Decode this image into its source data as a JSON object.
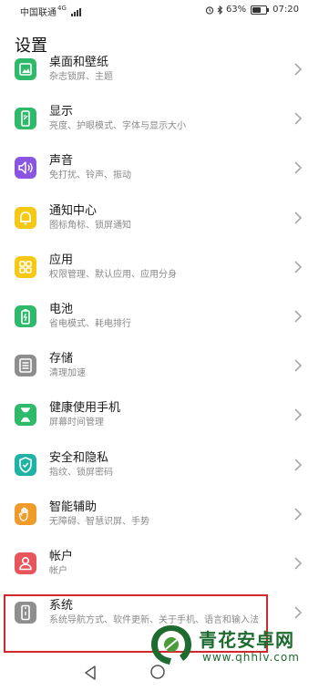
{
  "status_bar": {
    "carrier": "中国联通",
    "network": "4G",
    "battery_percent": "63%",
    "battery_level": 0.63,
    "time": "07:20"
  },
  "title": "设置",
  "items": [
    {
      "title": "桌面和壁纸",
      "subtitle": "杂志锁屏、主题",
      "icon": "wallpaper-icon",
      "color": "#2fba6b"
    },
    {
      "title": "显示",
      "subtitle": "亮度、护眼模式、字体与显示大小",
      "icon": "display-icon",
      "color": "#2fba6b"
    },
    {
      "title": "声音",
      "subtitle": "免打扰、铃声、振动",
      "icon": "sound-icon",
      "color": "#8a55e0"
    },
    {
      "title": "通知中心",
      "subtitle": "图标角标、锁屏通知",
      "icon": "bell-icon",
      "color": "#f5c814"
    },
    {
      "title": "应用",
      "subtitle": "权限管理、默认应用、应用分身",
      "icon": "apps-grid-icon",
      "color": "#f5c814"
    },
    {
      "title": "电池",
      "subtitle": "省电模式、耗电排行",
      "icon": "battery-icon",
      "color": "#2fba6b"
    },
    {
      "title": "存储",
      "subtitle": "清理加速",
      "icon": "storage-icon",
      "color": "#8e8e8e"
    },
    {
      "title": "健康使用手机",
      "subtitle": "屏幕时间管理",
      "icon": "hourglass-icon",
      "color": "#2fba6b"
    },
    {
      "title": "安全和隐私",
      "subtitle": "指纹、锁屏密码",
      "icon": "shield-icon",
      "color": "#1fb3a6"
    },
    {
      "title": "智能辅助",
      "subtitle": "无障碍、智慧识屏、手势",
      "icon": "hand-icon",
      "color": "#f09a2a"
    },
    {
      "title": "帐户",
      "subtitle": "帐户",
      "icon": "user-icon",
      "color": "#e8555a"
    },
    {
      "title": "系统",
      "subtitle": "系统导航方式、软件更新、关于手机、语言和输入法",
      "icon": "phone-icon",
      "color": "#8e8e8e"
    }
  ],
  "watermark": {
    "text": "青花安卓网",
    "url": "www.qhhlv.com"
  }
}
